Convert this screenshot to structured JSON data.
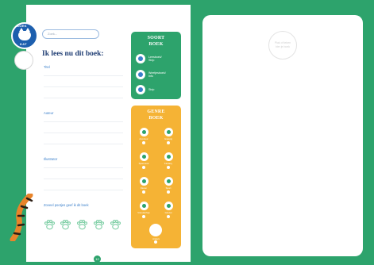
{
  "brand": {
    "logo_text_top": "BOEK",
    "logo_text_bottom": "KAT"
  },
  "search": {
    "placeholder": "Zoek..."
  },
  "form": {
    "title": "Ik lees nu dit boek:",
    "fields": [
      {
        "label": "Titel"
      },
      {
        "label": "Auteur"
      },
      {
        "label": "Illustrator"
      }
    ],
    "rating_label": "Zoveel pootjes geef ik dit boek",
    "rating_max": 5
  },
  "page_number": "12",
  "soort_panel": {
    "title_line1": "SOORT",
    "title_line2": "BOEK",
    "items": [
      {
        "label_line1": "Leesboek/",
        "label_line2": "Strip"
      },
      {
        "label_line1": "Weetjesboek/",
        "label_line2": "Info"
      },
      {
        "label_line1": "Strip",
        "label_line2": ""
      }
    ]
  },
  "genre_panel": {
    "title_line1": "GENRE",
    "title_line2": "BOEK",
    "items": [
      {
        "label": "Avontuur"
      },
      {
        "label": "Grappig"
      },
      {
        "label": "Spannend"
      },
      {
        "label": "Fantasy"
      },
      {
        "label": "Dieren"
      },
      {
        "label": "Sport"
      },
      {
        "label": "Vriendschap"
      },
      {
        "label": "Griezel"
      }
    ],
    "other_label": "Anders"
  },
  "right_page": {
    "placeholder_text": "Plak of teken hier je boek"
  },
  "colors": {
    "green": "#2da36c",
    "orange": "#f5b335",
    "blue": "#1f3d73",
    "accent_blue": "#3a7fca"
  }
}
